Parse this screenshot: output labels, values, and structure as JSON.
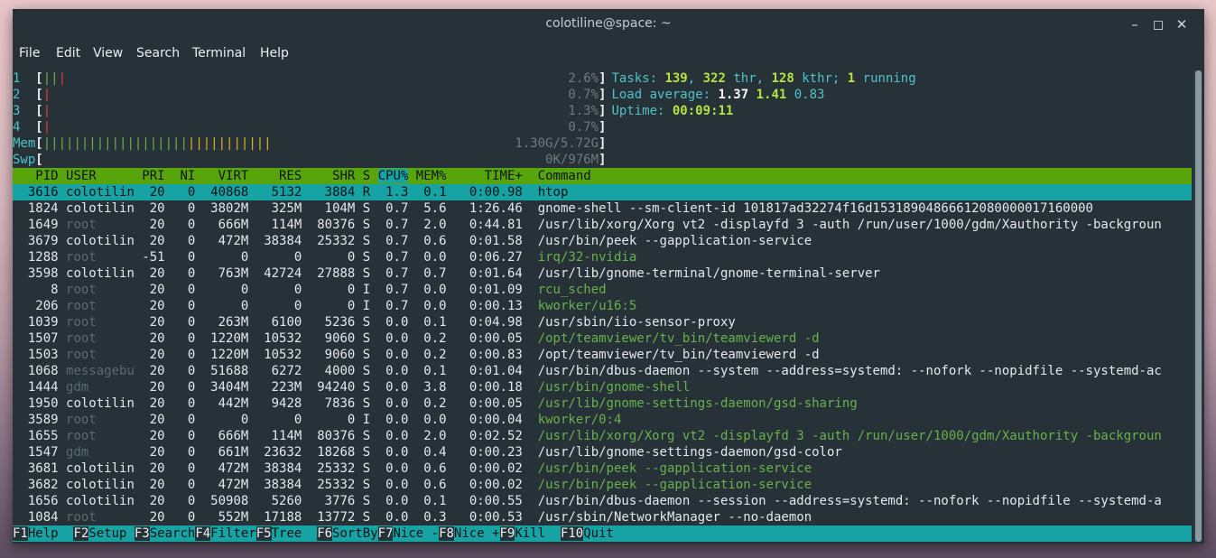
{
  "window": {
    "title": "colotiline@space: ~"
  },
  "menu": [
    "File",
    "Edit",
    "View",
    "Search",
    "Terminal",
    "Help"
  ],
  "colors": {
    "terminal_bg": "#263238",
    "header_bg": "#58a40b",
    "select_bg": "#17a3a3",
    "cyan": "#4fc3c7",
    "green": "#6ab04c"
  },
  "cpus": [
    {
      "label": "1",
      "value": "2.6%",
      "bars": [
        [
          "green",
          "|"
        ],
        [
          "green",
          "|"
        ],
        [
          "red",
          "|"
        ]
      ]
    },
    {
      "label": "2",
      "value": "0.7%",
      "bars": [
        [
          "red",
          "|"
        ]
      ]
    },
    {
      "label": "3",
      "value": "1.3%",
      "bars": [
        [
          "red",
          "|"
        ]
      ]
    },
    {
      "label": "4",
      "value": "0.7%",
      "bars": [
        [
          "red",
          "|"
        ]
      ]
    }
  ],
  "mem": {
    "label": "Mem",
    "value": "1.30G/5.72G",
    "green_bars": 19,
    "blue_bars": 0,
    "yellow_bars": 11
  },
  "swp": {
    "label": "Swp",
    "value": "0K/976M"
  },
  "stats": {
    "tasks_label": "Tasks: ",
    "tasks": "139",
    "thr": "322",
    "thr_label": " thr, ",
    "kthr": "128",
    "kthr_label": " kthr; ",
    "running": "1",
    "running_label": " running",
    "load_label": "Load average: ",
    "load1": "1.37",
    "load5": "1.41",
    "load15": "0.83",
    "uptime_label": "Uptime: ",
    "uptime": "00:09:11"
  },
  "columns": [
    "PID",
    "USER",
    "PRI",
    "NI",
    "VIRT",
    "RES",
    "SHR",
    "S",
    "CPU%",
    "MEM%",
    "TIME+",
    "Command"
  ],
  "processes": [
    {
      "pid": "3616",
      "user": "colotilin",
      "pri": "20",
      "ni": "0",
      "virt": "40868",
      "res": "5132",
      "shr": "3884",
      "s": "R",
      "cpu": "1.3",
      "mem": "0.1",
      "time": "0:00.98",
      "cmd": "htop",
      "selected": true
    },
    {
      "pid": "1824",
      "user": "colotilin",
      "pri": "20",
      "ni": "0",
      "virt": "3802M",
      "res": "325M",
      "shr": "104M",
      "s": "S",
      "cpu": "0.7",
      "mem": "5.6",
      "time": "1:26.46",
      "cmd": "gnome-shell --sm-client-id 101817ad32274f16d15318904866612080000017160000"
    },
    {
      "pid": "1649",
      "user": "root",
      "pri": "20",
      "ni": "0",
      "virt": "666M",
      "res": "114M",
      "shr": "80376",
      "s": "S",
      "cpu": "0.7",
      "mem": "2.0",
      "time": "0:44.81",
      "cmd": "/usr/lib/xorg/Xorg vt2 -displayfd 3 -auth /run/user/1000/gdm/Xauthority -backgroun"
    },
    {
      "pid": "3679",
      "user": "colotilin",
      "pri": "20",
      "ni": "0",
      "virt": "472M",
      "res": "38384",
      "shr": "25332",
      "s": "S",
      "cpu": "0.7",
      "mem": "0.6",
      "time": "0:01.58",
      "cmd": "/usr/bin/peek --gapplication-service"
    },
    {
      "pid": "1288",
      "user": "root",
      "pri": "-51",
      "ni": "0",
      "virt": "0",
      "res": "0",
      "shr": "0",
      "s": "S",
      "cpu": "0.7",
      "mem": "0.0",
      "time": "0:06.27",
      "cmd": "irq/32-nvidia",
      "green": true
    },
    {
      "pid": "3598",
      "user": "colotilin",
      "pri": "20",
      "ni": "0",
      "virt": "763M",
      "res": "42724",
      "shr": "27888",
      "s": "S",
      "cpu": "0.7",
      "mem": "0.7",
      "time": "0:01.64",
      "cmd": "/usr/lib/gnome-terminal/gnome-terminal-server"
    },
    {
      "pid": "8",
      "user": "root",
      "pri": "20",
      "ni": "0",
      "virt": "0",
      "res": "0",
      "shr": "0",
      "s": "I",
      "cpu": "0.7",
      "mem": "0.0",
      "time": "0:01.09",
      "cmd": "rcu_sched",
      "green": true
    },
    {
      "pid": "206",
      "user": "root",
      "pri": "20",
      "ni": "0",
      "virt": "0",
      "res": "0",
      "shr": "0",
      "s": "I",
      "cpu": "0.7",
      "mem": "0.0",
      "time": "0:00.13",
      "cmd": "kworker/u16:5",
      "green": true
    },
    {
      "pid": "1039",
      "user": "root",
      "pri": "20",
      "ni": "0",
      "virt": "263M",
      "res": "6100",
      "shr": "5236",
      "s": "S",
      "cpu": "0.0",
      "mem": "0.1",
      "time": "0:04.98",
      "cmd": "/usr/sbin/iio-sensor-proxy"
    },
    {
      "pid": "1507",
      "user": "root",
      "pri": "20",
      "ni": "0",
      "virt": "1220M",
      "res": "10532",
      "shr": "9060",
      "s": "S",
      "cpu": "0.0",
      "mem": "0.2",
      "time": "0:00.05",
      "cmd": "/opt/teamviewer/tv_bin/teamviewerd -d",
      "green": true
    },
    {
      "pid": "1503",
      "user": "root",
      "pri": "20",
      "ni": "0",
      "virt": "1220M",
      "res": "10532",
      "shr": "9060",
      "s": "S",
      "cpu": "0.0",
      "mem": "0.2",
      "time": "0:00.83",
      "cmd": "/opt/teamviewer/tv_bin/teamviewerd -d"
    },
    {
      "pid": "1068",
      "user": "messagebu",
      "pri": "20",
      "ni": "0",
      "virt": "51688",
      "res": "6272",
      "shr": "4000",
      "s": "S",
      "cpu": "0.0",
      "mem": "0.1",
      "time": "0:01.04",
      "cmd": "/usr/bin/dbus-daemon --system --address=systemd: --nofork --nopidfile --systemd-ac"
    },
    {
      "pid": "1444",
      "user": "gdm",
      "pri": "20",
      "ni": "0",
      "virt": "3404M",
      "res": "223M",
      "shr": "94240",
      "s": "S",
      "cpu": "0.0",
      "mem": "3.8",
      "time": "0:00.18",
      "cmd": "/usr/bin/gnome-shell",
      "green": true
    },
    {
      "pid": "1950",
      "user": "colotilin",
      "pri": "20",
      "ni": "0",
      "virt": "442M",
      "res": "9428",
      "shr": "7836",
      "s": "S",
      "cpu": "0.0",
      "mem": "0.2",
      "time": "0:00.05",
      "cmd": "/usr/lib/gnome-settings-daemon/gsd-sharing",
      "green": true
    },
    {
      "pid": "3589",
      "user": "root",
      "pri": "20",
      "ni": "0",
      "virt": "0",
      "res": "0",
      "shr": "0",
      "s": "I",
      "cpu": "0.0",
      "mem": "0.0",
      "time": "0:00.04",
      "cmd": "kworker/0:4",
      "green": true
    },
    {
      "pid": "1655",
      "user": "root",
      "pri": "20",
      "ni": "0",
      "virt": "666M",
      "res": "114M",
      "shr": "80376",
      "s": "S",
      "cpu": "0.0",
      "mem": "2.0",
      "time": "0:02.52",
      "cmd": "/usr/lib/xorg/Xorg vt2 -displayfd 3 -auth /run/user/1000/gdm/Xauthority -backgroun",
      "green": true
    },
    {
      "pid": "1547",
      "user": "gdm",
      "pri": "20",
      "ni": "0",
      "virt": "661M",
      "res": "23632",
      "shr": "18268",
      "s": "S",
      "cpu": "0.0",
      "mem": "0.4",
      "time": "0:00.23",
      "cmd": "/usr/lib/gnome-settings-daemon/gsd-color"
    },
    {
      "pid": "3681",
      "user": "colotilin",
      "pri": "20",
      "ni": "0",
      "virt": "472M",
      "res": "38384",
      "shr": "25332",
      "s": "S",
      "cpu": "0.0",
      "mem": "0.6",
      "time": "0:00.02",
      "cmd": "/usr/bin/peek --gapplication-service",
      "green": true
    },
    {
      "pid": "3682",
      "user": "colotilin",
      "pri": "20",
      "ni": "0",
      "virt": "472M",
      "res": "38384",
      "shr": "25332",
      "s": "S",
      "cpu": "0.0",
      "mem": "0.6",
      "time": "0:00.02",
      "cmd": "/usr/bin/peek --gapplication-service",
      "green": true
    },
    {
      "pid": "1656",
      "user": "colotilin",
      "pri": "20",
      "ni": "0",
      "virt": "50908",
      "res": "5260",
      "shr": "3776",
      "s": "S",
      "cpu": "0.0",
      "mem": "0.1",
      "time": "0:00.55",
      "cmd": "/usr/bin/dbus-daemon --session --address=systemd: --nofork --nopidfile --systemd-a"
    },
    {
      "pid": "1084",
      "user": "root",
      "pri": "20",
      "ni": "0",
      "virt": "552M",
      "res": "17188",
      "shr": "13772",
      "s": "S",
      "cpu": "0.0",
      "mem": "0.3",
      "time": "0:00.53",
      "cmd": "/usr/sbin/NetworkManager --no-daemon"
    }
  ],
  "fkeys": [
    {
      "key": "F1",
      "label": "Help  "
    },
    {
      "key": "F2",
      "label": "Setup "
    },
    {
      "key": "F3",
      "label": "Search"
    },
    {
      "key": "F4",
      "label": "Filter"
    },
    {
      "key": "F5",
      "label": "Tree  "
    },
    {
      "key": "F6",
      "label": "SortBy"
    },
    {
      "key": "F7",
      "label": "Nice -"
    },
    {
      "key": "F8",
      "label": "Nice +"
    },
    {
      "key": "F9",
      "label": "Kill  "
    },
    {
      "key": "F10",
      "label": "Quit"
    }
  ]
}
